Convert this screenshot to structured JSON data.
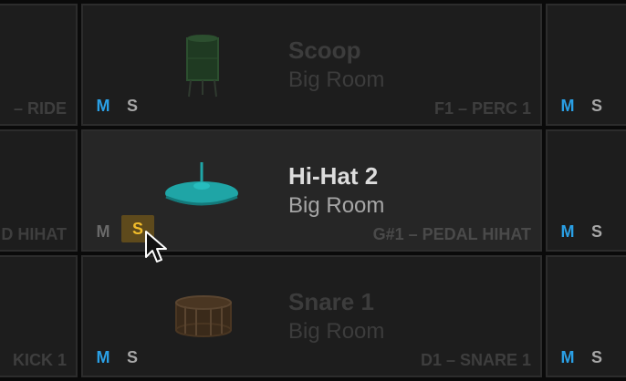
{
  "colors": {
    "background": "#0a0a0a",
    "pad": "#232323",
    "mute_active": "#2aa0e6",
    "solo_active_text": "#f2bd2b",
    "solo_active_bg": "#5e4a1c",
    "hihat_icon": "#1fa5a6"
  },
  "left_column": {
    "row1_note": "– RIDE",
    "row2_note": "D HIHAT",
    "row3_note": "KICK 1"
  },
  "pads": [
    {
      "title": "Scoop",
      "subtitle": "Big Room",
      "note": "F1 – PERC 1",
      "mute": "M",
      "solo": "S",
      "icon": "floor-tom-icon",
      "state": "dim"
    },
    {
      "title": "Hi-Hat 2",
      "subtitle": "Big Room",
      "note": "G#1 – PEDAL HIHAT",
      "mute": "M",
      "solo": "S",
      "icon": "hihat-icon",
      "state": "active",
      "solo_on": true
    },
    {
      "title": "Snare 1",
      "subtitle": "Big Room",
      "note": "D1 – SNARE 1",
      "mute": "M",
      "solo": "S",
      "icon": "snare-drum-icon",
      "state": "dim"
    }
  ],
  "right_column": [
    {
      "mute": "M",
      "solo": "S"
    },
    {
      "mute": "M",
      "solo": "S"
    },
    {
      "mute": "M",
      "solo": "S"
    }
  ]
}
